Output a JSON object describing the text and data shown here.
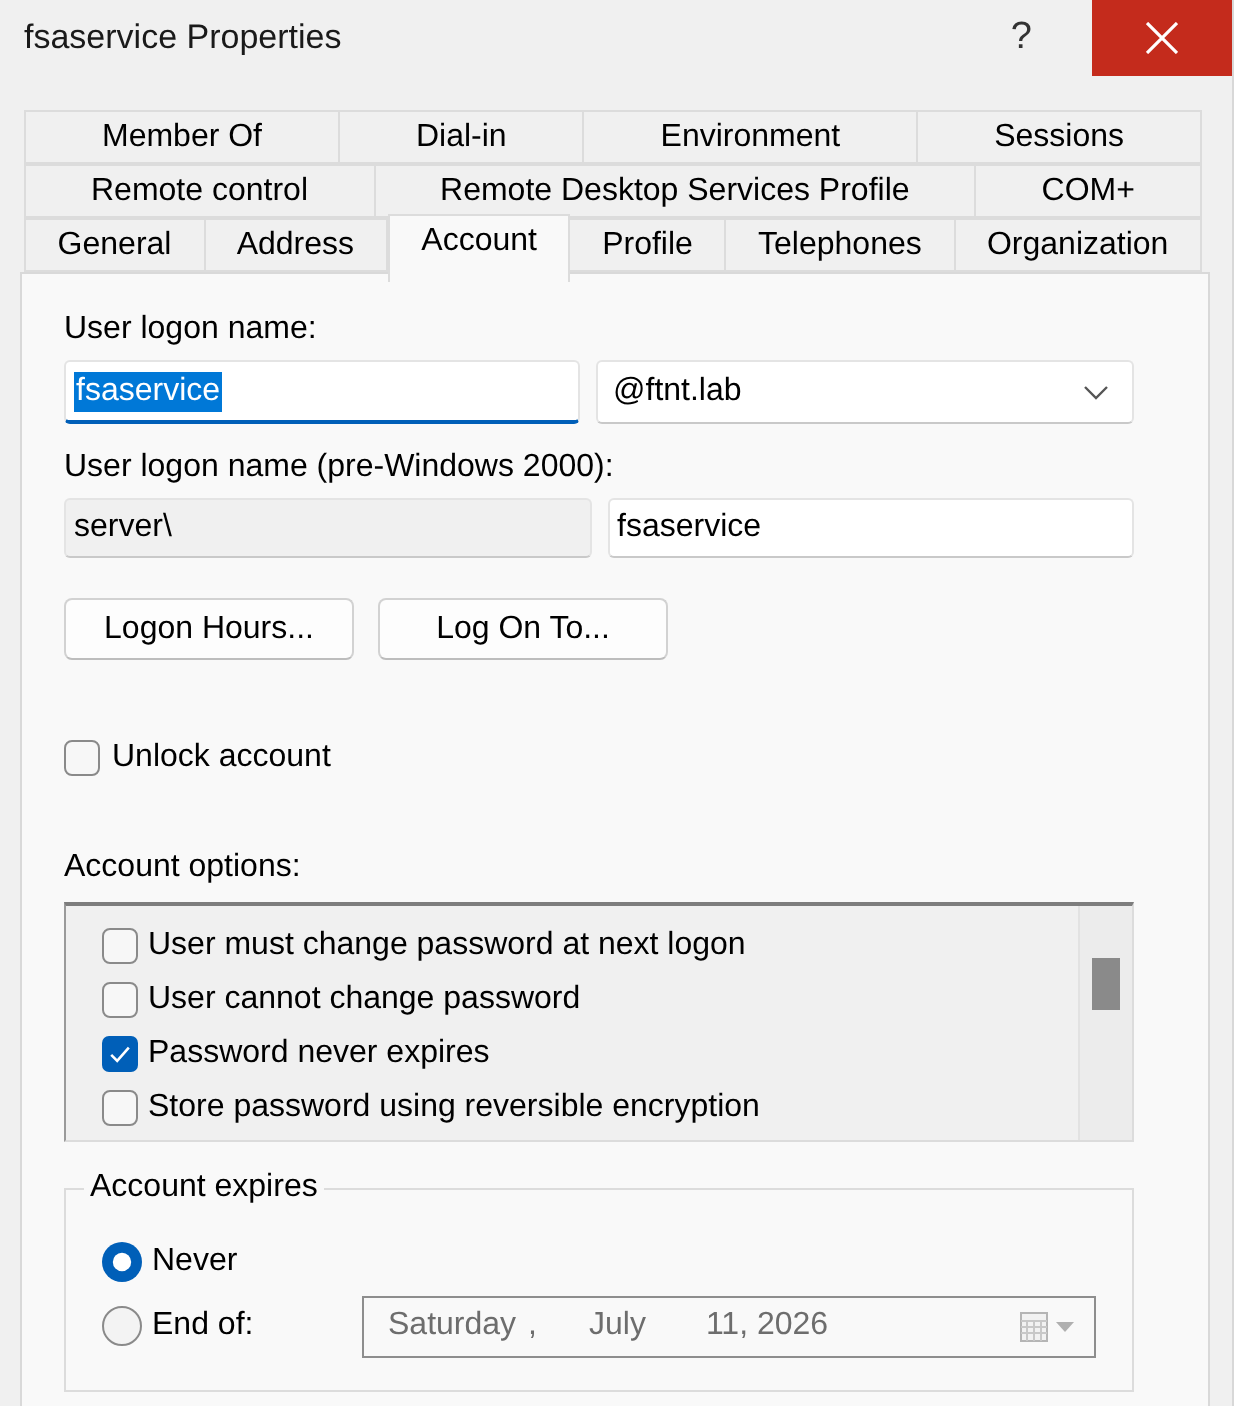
{
  "window": {
    "title": "fsaservice Properties",
    "help_button": "?"
  },
  "tab_rows": [
    {
      "tabs": [
        {
          "label": "Member Of",
          "selected": false
        },
        {
          "label": "Dial-in",
          "selected": false
        },
        {
          "label": "Environment",
          "selected": false
        },
        {
          "label": "Sessions",
          "selected": false
        }
      ]
    },
    {
      "tabs": [
        {
          "label": "Remote control",
          "selected": false
        },
        {
          "label": "Remote Desktop Services Profile",
          "selected": false
        },
        {
          "label": "COM+",
          "selected": false
        }
      ]
    },
    {
      "tabs": [
        {
          "label": "General",
          "selected": false
        },
        {
          "label": "Address",
          "selected": false
        },
        {
          "label": "Account",
          "selected": true
        },
        {
          "label": "Profile",
          "selected": false
        },
        {
          "label": "Telephones",
          "selected": false
        },
        {
          "label": "Organization",
          "selected": false
        }
      ]
    }
  ],
  "user_logon_name": {
    "label": "User logon name:",
    "name_field": {
      "value": "fsaservice",
      "focused": true,
      "text_selected": true
    },
    "domain_dropdown": {
      "value": "@ftnt.lab"
    }
  },
  "pre_windows_2000": {
    "label": "User logon name (pre-Windows 2000):",
    "domain_field": {
      "value": "server\\",
      "read_only": true
    },
    "name_field": {
      "value": "fsaservice",
      "read_only": false
    }
  },
  "buttons": [
    {
      "label": "Logon Hours..."
    },
    {
      "label": "Log On To..."
    }
  ],
  "unlock_account": {
    "label": "Unlock account",
    "checked": false
  },
  "account_options": {
    "label": "Account options:",
    "items": [
      {
        "label": "User must change password at next logon",
        "checked": false
      },
      {
        "label": "User cannot change password",
        "checked": false
      },
      {
        "label": "Password never expires",
        "checked": true
      },
      {
        "label": "Store password using reversible encryption",
        "checked": false
      }
    ]
  },
  "account_expires": {
    "legend": "Account expires",
    "options": [
      {
        "label": "Never",
        "selected": true
      },
      {
        "label": "End of:",
        "selected": false,
        "date_picker": {
          "weekday": "Saturday",
          "separator": ",",
          "month": "July",
          "day_year": "11, 2026",
          "disabled": true
        }
      }
    ]
  }
}
